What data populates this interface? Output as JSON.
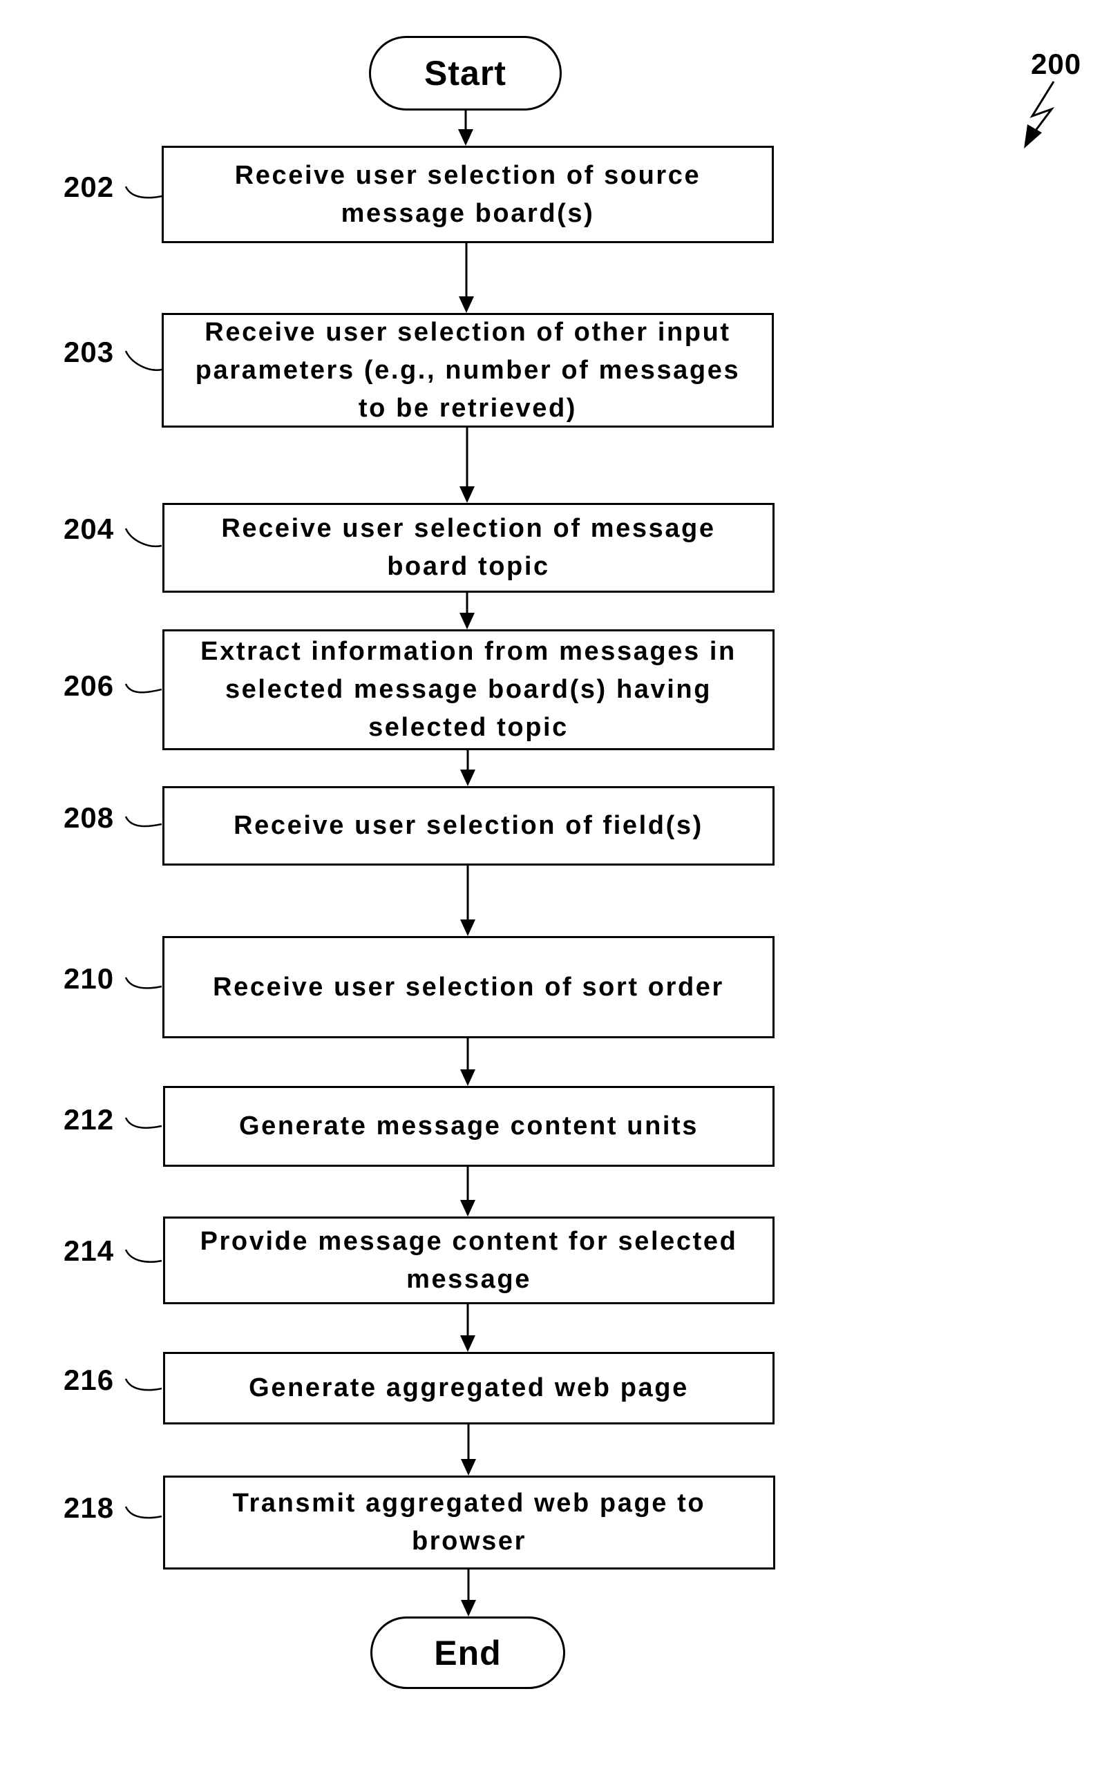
{
  "figure": {
    "reference_numeral": "200",
    "start_label": "Start",
    "end_label": "End",
    "steps": [
      {
        "id": "202",
        "text": "Receive user selection of source message board(s)",
        "lines": [
          "Receive user selection of source",
          "message board(s)"
        ]
      },
      {
        "id": "203",
        "text": "Receive user selection of other input parameters (e.g., number of messages to be retrieved)",
        "lines": [
          "Receive user selection of other input",
          "parameters (e.g., number of messages",
          "to be retrieved)"
        ]
      },
      {
        "id": "204",
        "text": "Receive user selection of message board topic",
        "lines": [
          "Receive user selection of message",
          "board topic"
        ]
      },
      {
        "id": "206",
        "text": "Extract information from messages in selected message board(s) having selected topic",
        "lines": [
          "Extract information from messages in",
          "selected message board(s) having",
          "selected topic"
        ]
      },
      {
        "id": "208",
        "text": "Receive user selection of field(s)",
        "lines": [
          "Receive user selection of field(s)"
        ]
      },
      {
        "id": "210",
        "text": "Receive user selection of sort order",
        "lines": [
          "Receive user selection of sort order"
        ]
      },
      {
        "id": "212",
        "text": "Generate message content units",
        "lines": [
          "Generate message content units"
        ]
      },
      {
        "id": "214",
        "text": "Provide message content for selected message",
        "lines": [
          "Provide message content for selected",
          "message"
        ]
      },
      {
        "id": "216",
        "text": "Generate aggregated web page",
        "lines": [
          "Generate aggregated web page"
        ]
      },
      {
        "id": "218",
        "text": "Transmit aggregated web page to browser",
        "lines": [
          "Transmit aggregated web page to",
          "browser"
        ]
      }
    ],
    "flow": [
      "start",
      "202",
      "203",
      "204",
      "206",
      "208",
      "210",
      "212",
      "214",
      "216",
      "218",
      "end"
    ],
    "colors": {
      "stroke": "#000000",
      "background": "#ffffff"
    }
  }
}
